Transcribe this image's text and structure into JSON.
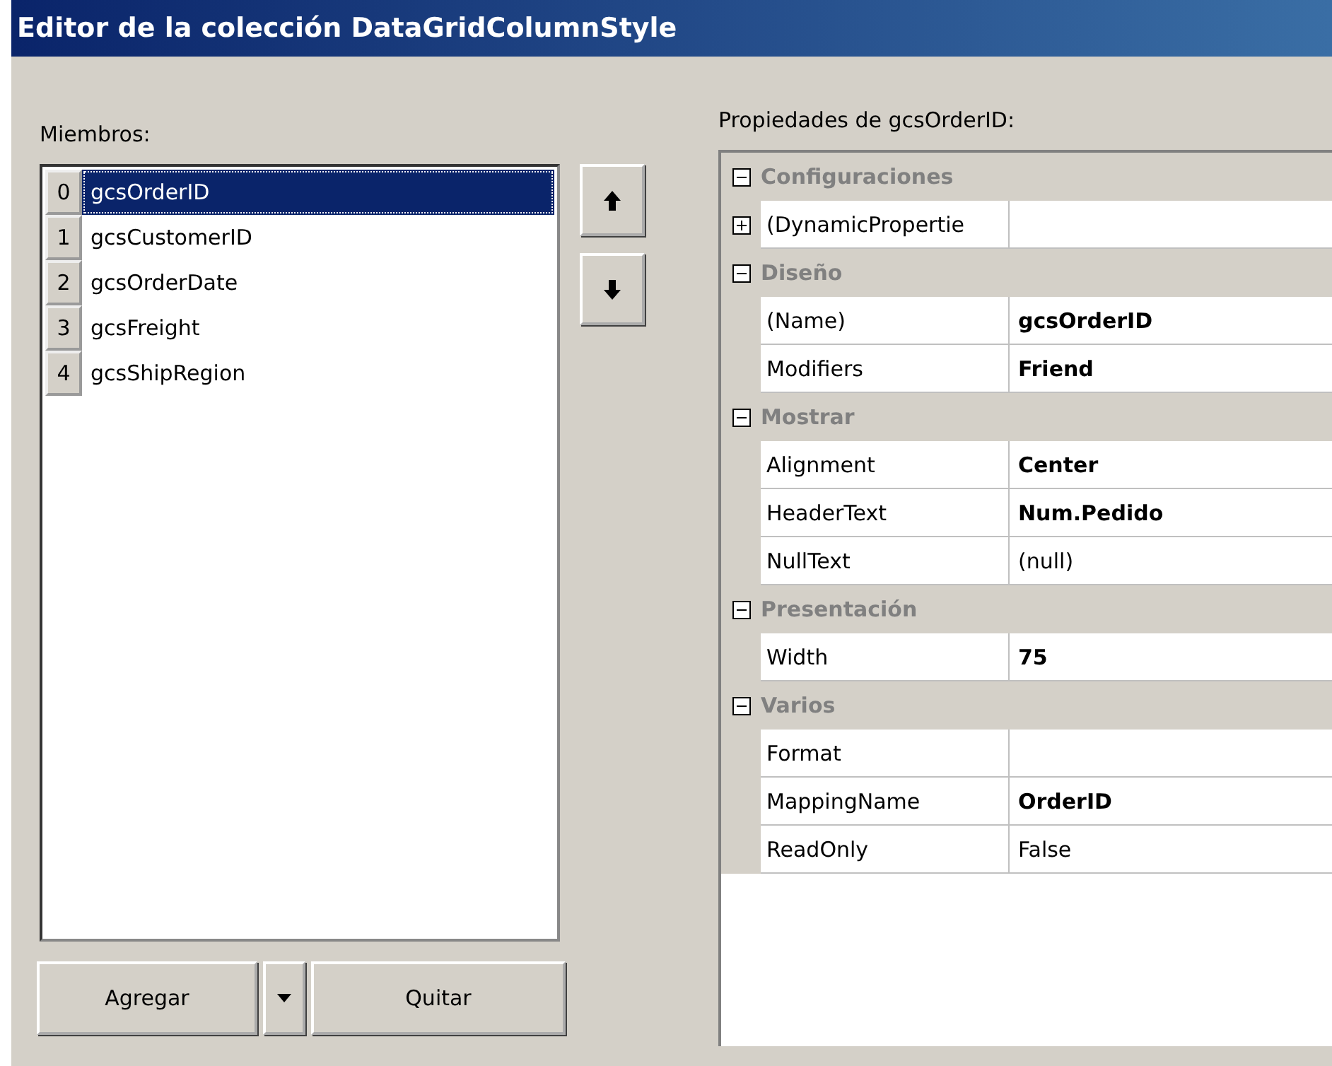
{
  "window": {
    "title": "Editor de la colección DataGridColumnStyle"
  },
  "members": {
    "label": "Miembros:",
    "items": [
      {
        "index": "0",
        "name": "gcsOrderID",
        "selected": true
      },
      {
        "index": "1",
        "name": "gcsCustomerID",
        "selected": false
      },
      {
        "index": "2",
        "name": "gcsOrderDate",
        "selected": false
      },
      {
        "index": "3",
        "name": "gcsFreight",
        "selected": false
      },
      {
        "index": "4",
        "name": "gcsShipRegion",
        "selected": false
      }
    ]
  },
  "buttons": {
    "add": "Agregar",
    "remove": "Quitar"
  },
  "properties": {
    "label": "Propiedades de gcsOrderID:",
    "categories": [
      {
        "name": "Configuraciones",
        "expanded": true,
        "properties": [
          {
            "name": "(DynamicPropertie",
            "bold": false,
            "expanded": false
          }
        ]
      },
      {
        "name": "Diseño",
        "expanded": true,
        "properties": [
          {
            "name": "(Name)",
            "value": "gcsOrderID",
            "bold": true
          },
          {
            "name": "Modifiers",
            "value": "Friend",
            "bold": true
          }
        ]
      },
      {
        "name": "Mostrar",
        "expanded": true,
        "properties": [
          {
            "name": "Alignment",
            "value": "Center",
            "bold": true
          },
          {
            "name": "HeaderText",
            "value": "Num.Pedido",
            "bold": true
          },
          {
            "name": "NullText",
            "value": "(null)",
            "bold": false
          }
        ]
      },
      {
        "name": "Presentación",
        "expanded": true,
        "properties": [
          {
            "name": "Width",
            "value": "75",
            "bold": true
          }
        ]
      },
      {
        "name": "Varios",
        "expanded": true,
        "properties": [
          {
            "name": "Format",
            "bold": false
          },
          {
            "name": "MappingName",
            "value": "OrderID",
            "bold": true
          },
          {
            "name": "ReadOnly",
            "value": "False",
            "bold": false
          }
        ]
      }
    ]
  }
}
